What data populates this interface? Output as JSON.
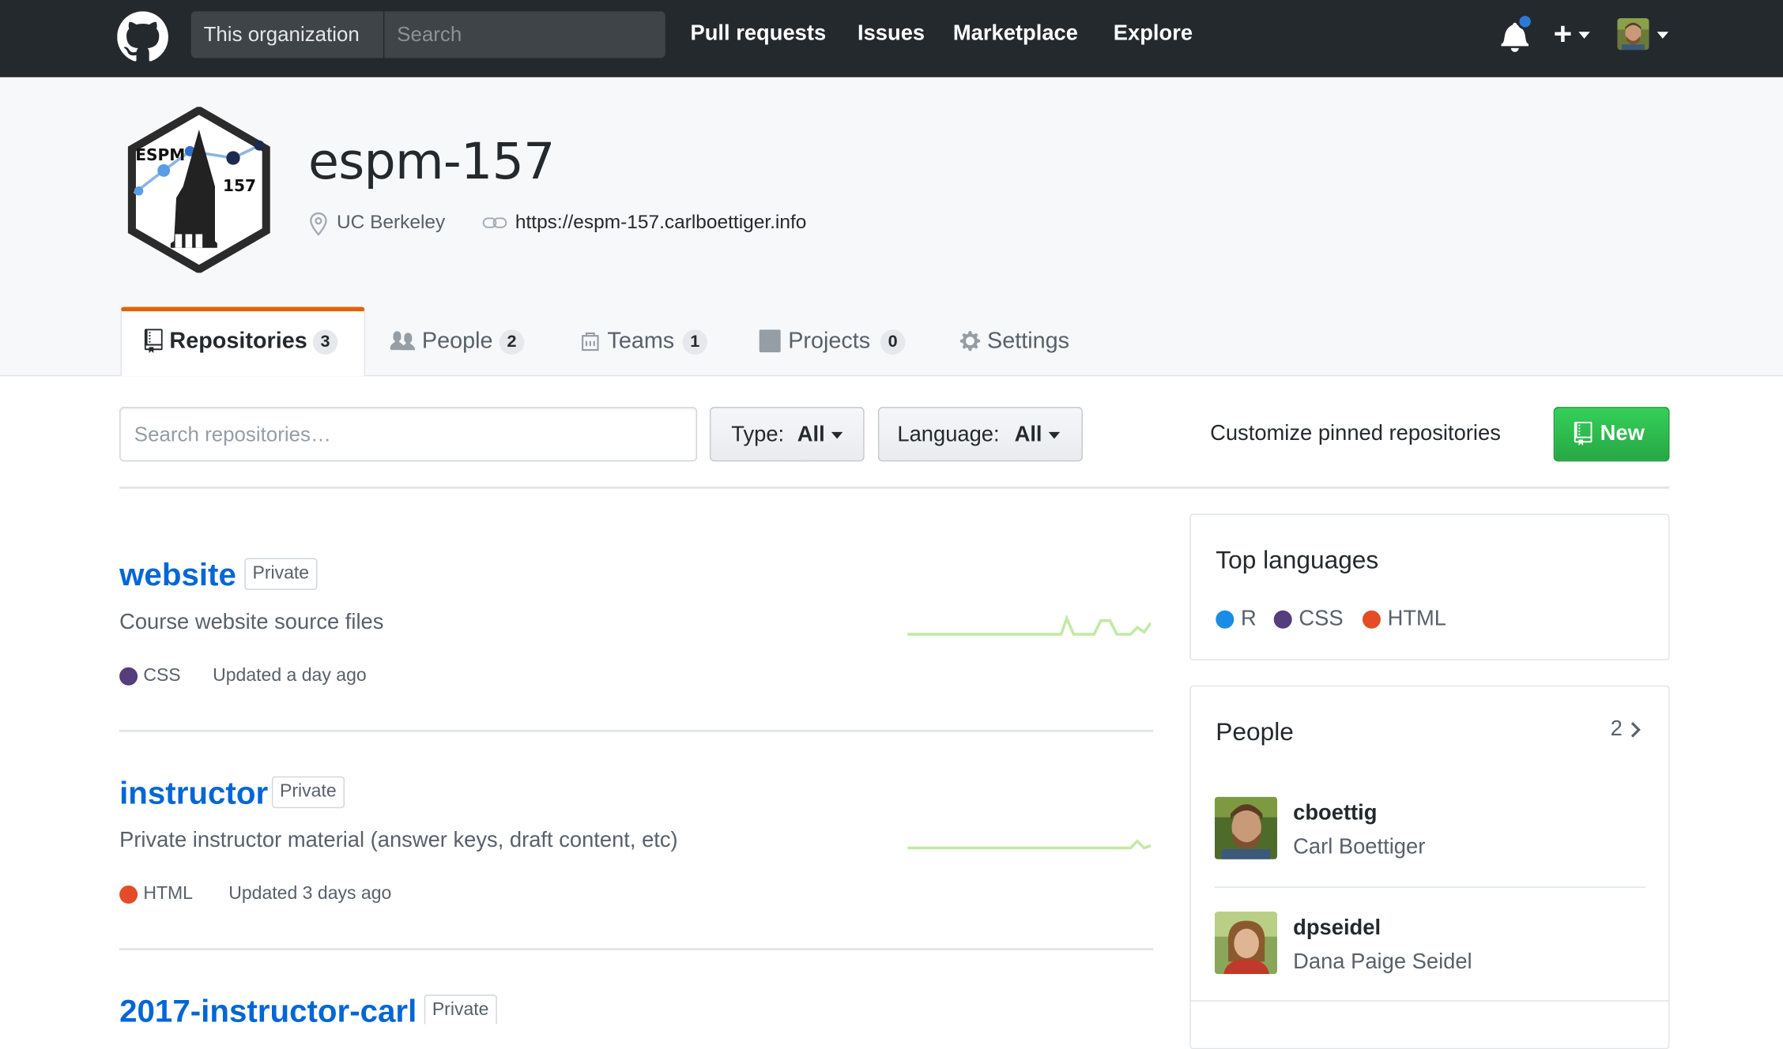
{
  "header": {
    "search_scope": "This organization",
    "search_placeholder": "Search",
    "nav": [
      "Pull requests",
      "Issues",
      "Marketplace",
      "Explore"
    ],
    "notification_unread": true,
    "plus_label": "+"
  },
  "org": {
    "logo_text_top": "ESPM",
    "logo_text_num": "157",
    "name": "espm-157",
    "location": "UC Berkeley",
    "url": "https://espm-157.carlboettiger.info"
  },
  "tabs": [
    {
      "label": "Repositories",
      "count": "3",
      "active": true
    },
    {
      "label": "People",
      "count": "2",
      "active": false
    },
    {
      "label": "Teams",
      "count": "1",
      "active": false
    },
    {
      "label": "Projects",
      "count": "0",
      "active": false
    },
    {
      "label": "Settings",
      "count": null,
      "active": false
    }
  ],
  "filters": {
    "search_placeholder": "Search repositories…",
    "type_label": "Type:",
    "type_value": "All",
    "language_label": "Language:",
    "language_value": "All",
    "customize": "Customize pinned repositories",
    "new_label": "New"
  },
  "repos": [
    {
      "name": "website",
      "visibility": "Private",
      "description": "Course website source files",
      "language": "CSS",
      "language_color": "#563d7c",
      "updated": "Updated a day ago"
    },
    {
      "name": "instructor",
      "visibility": "Private",
      "description": "Private instructor material (answer keys, draft content, etc)",
      "language": "HTML",
      "language_color": "#e34c26",
      "updated": "Updated 3 days ago"
    },
    {
      "name": "2017-instructor-carl",
      "visibility": "Private"
    }
  ],
  "sidebar": {
    "top_languages_title": "Top languages",
    "languages": [
      {
        "name": "R",
        "color": "#198ce7"
      },
      {
        "name": "CSS",
        "color": "#563d7c"
      },
      {
        "name": "HTML",
        "color": "#e34c26"
      }
    ],
    "people_title": "People",
    "people_count": "2",
    "people": [
      {
        "login": "cboettig",
        "name": "Carl Boettiger"
      },
      {
        "login": "dpseidel",
        "name": "Dana Paige Seidel"
      }
    ]
  },
  "colors": {
    "header_bg": "#24292e",
    "link": "#0366d6",
    "tab_accent": "#e36209",
    "new_button": "#28a745",
    "spark": "#c2e9a6"
  }
}
